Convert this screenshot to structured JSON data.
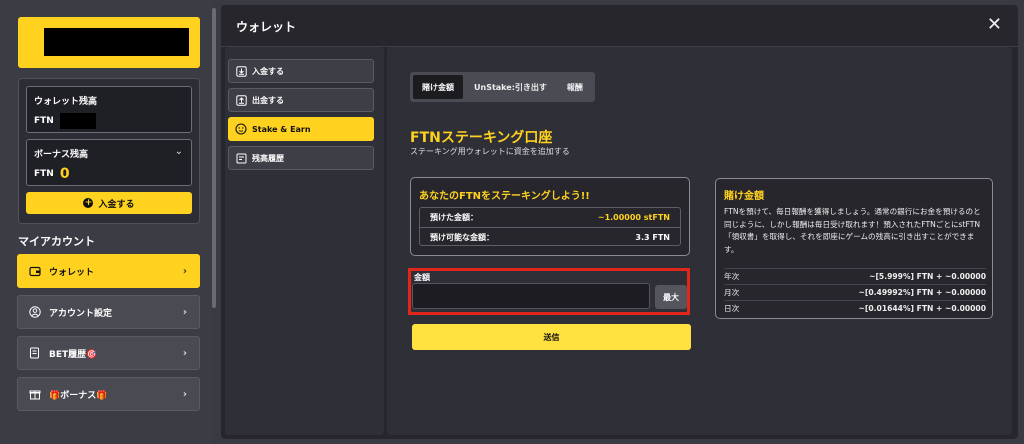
{
  "sidebar": {
    "wallet_balance_label": "ウォレット残高",
    "wallet_currency": "FTN",
    "bonus_label": "ボーナス残高",
    "bonus_currency": "FTN",
    "bonus_value": "0",
    "deposit_label": "入金する",
    "my_account_label": "マイアカウント",
    "nav": [
      {
        "label": "ウォレット",
        "icon": "wallet-icon"
      },
      {
        "label": "アカウント設定",
        "icon": "user-icon"
      },
      {
        "label": "BET履歴🎯",
        "icon": "bet-history-icon"
      },
      {
        "label": "🎁ボーナス🎁",
        "icon": "gift-icon"
      }
    ]
  },
  "modal": {
    "title": "ウォレット",
    "menu": [
      {
        "label": "入金する",
        "icon": "deposit-icon"
      },
      {
        "label": "出金する",
        "icon": "withdraw-icon"
      },
      {
        "label": "Stake & Earn",
        "icon": "stake-icon"
      },
      {
        "label": "残高履歴",
        "icon": "history-icon"
      }
    ],
    "tabs": [
      "賭け金額",
      "UnStake:引き出す",
      "報酬"
    ],
    "ftn_title": "FTNステーキング口座",
    "ftn_subtitle": "ステーキング用ウォレットに資金を追加する",
    "stake_card": {
      "title": "あなたのFTNをステーキングしよう!!",
      "rows": [
        {
          "label": "預けた金額：",
          "value": "~1.00000 stFTN"
        },
        {
          "label": "預け可能な金額：",
          "value": "3.3 FTN"
        }
      ]
    },
    "amount_label": "金額",
    "amount_value": "",
    "max_label": "最大",
    "send_label": "送信",
    "info_card": {
      "title": "賭け金額",
      "text": "FTNを預けて、毎日報酬を獲得しましょう。通常の銀行にお金を預けるのと同じように、しかし報酬は毎日受け取れます！預入されたFTNごとにstFTN「領収書」を取得し、それを即座にゲームの残高に引き出すことができます。",
      "rows": [
        {
          "label": "年次",
          "value": "~[5.999%] FTN + ~0.00000"
        },
        {
          "label": "月次",
          "value": "~[0.49992%] FTN + ~0.00000"
        },
        {
          "label": "日次",
          "value": "~[0.01644%] FTN + ~0.00000"
        }
      ]
    }
  },
  "colors": {
    "accent": "#ffd21f",
    "highlight": "#e1261c",
    "modal_bg": "#26262c"
  }
}
